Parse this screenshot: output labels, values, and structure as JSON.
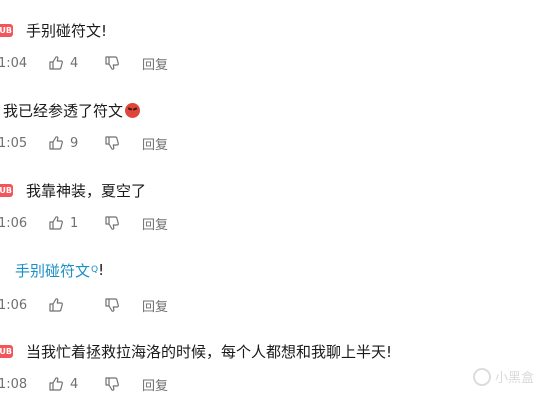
{
  "comments": [
    {
      "badge": "UB",
      "text": "手别碰符文!",
      "time": "1:04",
      "likes": "4",
      "reply_label": "回复"
    },
    {
      "text": "我已经参透了符文",
      "emoji": "angry-face-emoji",
      "time": "1:05",
      "likes": "9",
      "reply_label": "回复"
    },
    {
      "badge": "UB",
      "text": "我靠神装，夏空了",
      "time": "1:06",
      "likes": "1",
      "reply_label": "回复"
    },
    {
      "link_text": "手别碰符文",
      "link_suffix": "Q",
      "trailing": "!",
      "time": "1:06",
      "reply_label": "回复"
    },
    {
      "badge": "UB",
      "text": "当我忙着拯救拉海洛的时候，每个人都想和我聊上半天!",
      "time": "1:08",
      "likes": "4",
      "reply_label": "回复"
    }
  ],
  "watermark": "小黑盒",
  "colors": {
    "badge": "#f2555a",
    "link": "#1a8fc9",
    "meta": "#707070"
  }
}
